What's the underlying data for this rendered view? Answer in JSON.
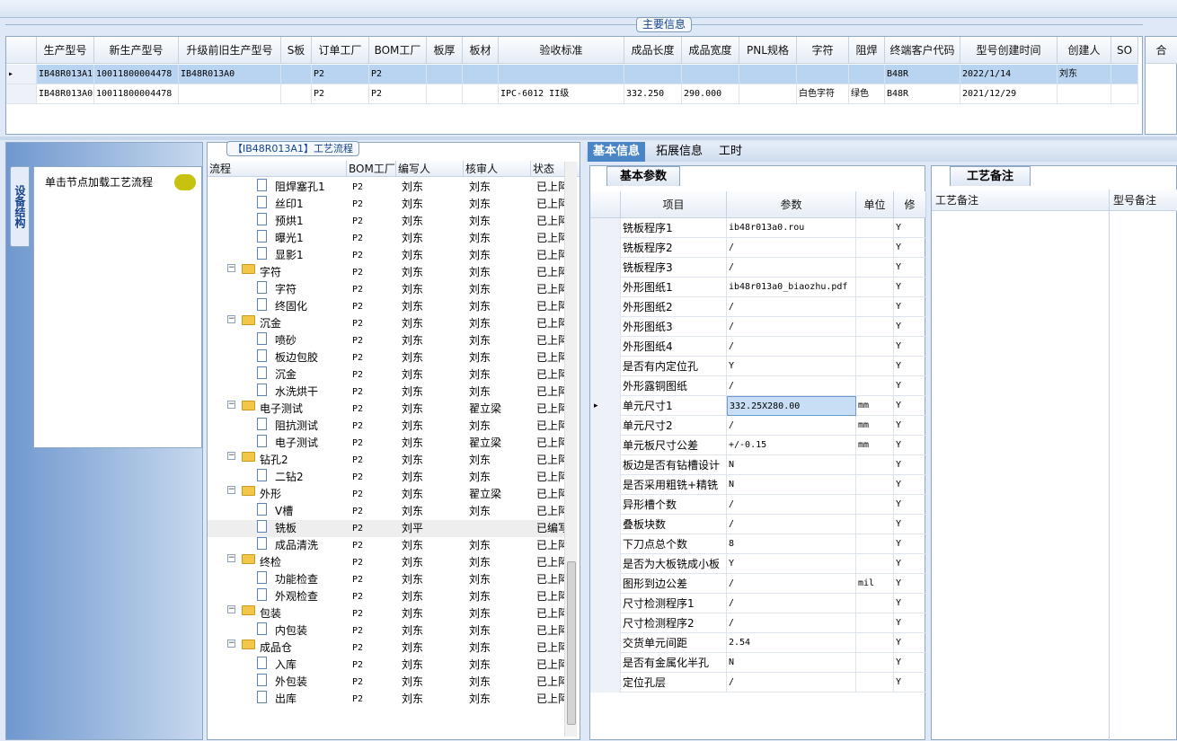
{
  "group_title": "主要信息",
  "top_grid": {
    "headers": [
      "生产型号",
      "新生产型号",
      "升级前旧生产型号",
      "S板",
      "订单工厂",
      "BOM工厂",
      "板厚",
      "板材",
      "验收标准",
      "成品长度",
      "成品宽度",
      "PNL规格",
      "字符",
      "阻焊",
      "终端客户代码",
      "型号创建时间",
      "创建人",
      "SO"
    ],
    "rows": [
      [
        "IB48R013A1",
        "10011800004478",
        "IB48R013A0",
        "",
        "P2",
        "P2",
        "",
        "",
        "",
        "",
        "",
        "",
        "",
        "",
        "B48R",
        "2022/1/14",
        "刘东",
        ""
      ],
      [
        "IB48R013A0",
        "10011800004478",
        "",
        "",
        "P2",
        "P2",
        "",
        "",
        "IPC-6012 II级",
        "332.250",
        "290.000",
        "",
        "白色字符",
        "绿色",
        "B48R",
        "2021/12/29",
        "",
        ""
      ]
    ],
    "extra_header": "合"
  },
  "left_panel": {
    "side_tab": "设备结构",
    "hint": "单击节点加载工艺流程"
  },
  "flow": {
    "title": "【IB48R013A1】工艺流程",
    "headers": [
      "流程",
      "BOM工厂",
      "编写人",
      "核审人",
      "状态"
    ],
    "rows": [
      {
        "name": "阻焊塞孔1",
        "level": 2,
        "bom": "P2",
        "writer": "刘东",
        "checker": "刘东",
        "status": "已上阿"
      },
      {
        "name": "丝印1",
        "level": 2,
        "bom": "P2",
        "writer": "刘东",
        "checker": "刘东",
        "status": "已上阿"
      },
      {
        "name": "预烘1",
        "level": 2,
        "bom": "P2",
        "writer": "刘东",
        "checker": "刘东",
        "status": "已上阿"
      },
      {
        "name": "曝光1",
        "level": 2,
        "bom": "P2",
        "writer": "刘东",
        "checker": "刘东",
        "status": "已上阿"
      },
      {
        "name": "显影1",
        "level": 2,
        "bom": "P2",
        "writer": "刘东",
        "checker": "刘东",
        "status": "已上阿"
      },
      {
        "name": "字符",
        "level": 1,
        "bom": "P2",
        "writer": "刘东",
        "checker": "刘东",
        "status": "已上阿"
      },
      {
        "name": "字符",
        "level": 2,
        "bom": "P2",
        "writer": "刘东",
        "checker": "刘东",
        "status": "已上阿"
      },
      {
        "name": "终固化",
        "level": 2,
        "bom": "P2",
        "writer": "刘东",
        "checker": "刘东",
        "status": "已上阿"
      },
      {
        "name": "沉金",
        "level": 1,
        "bom": "P2",
        "writer": "刘东",
        "checker": "刘东",
        "status": "已上阿"
      },
      {
        "name": "喷砂",
        "level": 2,
        "bom": "P2",
        "writer": "刘东",
        "checker": "刘东",
        "status": "已上阿"
      },
      {
        "name": "板边包胶",
        "level": 2,
        "bom": "P2",
        "writer": "刘东",
        "checker": "刘东",
        "status": "已上阿"
      },
      {
        "name": "沉金",
        "level": 2,
        "bom": "P2",
        "writer": "刘东",
        "checker": "刘东",
        "status": "已上阿"
      },
      {
        "name": "水洗烘干",
        "level": 2,
        "bom": "P2",
        "writer": "刘东",
        "checker": "刘东",
        "status": "已上阿"
      },
      {
        "name": "电子测试",
        "level": 1,
        "bom": "P2",
        "writer": "刘东",
        "checker": "翟立梁",
        "status": "已上阿"
      },
      {
        "name": "阻抗测试",
        "level": 2,
        "bom": "P2",
        "writer": "刘东",
        "checker": "刘东",
        "status": "已上阿"
      },
      {
        "name": "电子测试",
        "level": 2,
        "bom": "P2",
        "writer": "刘东",
        "checker": "翟立梁",
        "status": "已上阿"
      },
      {
        "name": "钻孔2",
        "level": 1,
        "bom": "P2",
        "writer": "刘东",
        "checker": "刘东",
        "status": "已上阿"
      },
      {
        "name": "二钻2",
        "level": 2,
        "bom": "P2",
        "writer": "刘东",
        "checker": "刘东",
        "status": "已上阿"
      },
      {
        "name": "外形",
        "level": 1,
        "bom": "P2",
        "writer": "刘东",
        "checker": "翟立梁",
        "status": "已上阿"
      },
      {
        "name": "V槽",
        "level": 2,
        "bom": "P2",
        "writer": "刘东",
        "checker": "刘东",
        "status": "已上阿"
      },
      {
        "name": "铣板",
        "level": 2,
        "bom": "P2",
        "writer": "刘平",
        "checker": "",
        "status": "已编写"
      },
      {
        "name": "成品清洗",
        "level": 2,
        "bom": "P2",
        "writer": "刘东",
        "checker": "刘东",
        "status": "已上阿"
      },
      {
        "name": "终检",
        "level": 1,
        "bom": "P2",
        "writer": "刘东",
        "checker": "刘东",
        "status": "已上阿"
      },
      {
        "name": "功能检查",
        "level": 2,
        "bom": "P2",
        "writer": "刘东",
        "checker": "刘东",
        "status": "已上阿"
      },
      {
        "name": "外观检查",
        "level": 2,
        "bom": "P2",
        "writer": "刘东",
        "checker": "刘东",
        "status": "已上阿"
      },
      {
        "name": "包装",
        "level": 1,
        "bom": "P2",
        "writer": "刘东",
        "checker": "刘东",
        "status": "已上阿"
      },
      {
        "name": "内包装",
        "level": 2,
        "bom": "P2",
        "writer": "刘东",
        "checker": "刘东",
        "status": "已上阿"
      },
      {
        "name": "成品仓",
        "level": 1,
        "bom": "P2",
        "writer": "刘东",
        "checker": "刘东",
        "status": "已上阿"
      },
      {
        "name": "入库",
        "level": 2,
        "bom": "P2",
        "writer": "刘东",
        "checker": "刘东",
        "status": "已上阿"
      },
      {
        "name": "外包装",
        "level": 2,
        "bom": "P2",
        "writer": "刘东",
        "checker": "刘东",
        "status": "已上阿"
      },
      {
        "name": "出库",
        "level": 2,
        "bom": "P2",
        "writer": "刘东",
        "checker": "刘东",
        "status": "已上阿"
      }
    ]
  },
  "detail_tabs": [
    "基本信息",
    "拓展信息",
    "工时"
  ],
  "params": {
    "title": "基本参数",
    "headers": [
      "项目",
      "参数",
      "单位",
      "修"
    ],
    "rows": [
      [
        "铣板程序1",
        "ib48r013a0.rou",
        "",
        "Y"
      ],
      [
        "铣板程序2",
        "/",
        "",
        "Y"
      ],
      [
        "铣板程序3",
        "/",
        "",
        "Y"
      ],
      [
        "外形图纸1",
        "ib48r013a0_biaozhu.pdf",
        "",
        "Y"
      ],
      [
        "外形图纸2",
        "/",
        "",
        "Y"
      ],
      [
        "外形图纸3",
        "/",
        "",
        "Y"
      ],
      [
        "外形图纸4",
        "/",
        "",
        "Y"
      ],
      [
        "是否有内定位孔",
        "Y",
        "",
        "Y"
      ],
      [
        "外形露铜图纸",
        "/",
        "",
        "Y"
      ],
      [
        "单元尺寸1",
        "332.25X280.00",
        "mm",
        "Y"
      ],
      [
        "单元尺寸2",
        "/",
        "mm",
        "Y"
      ],
      [
        "单元板尺寸公差",
        "+/-0.15",
        "mm",
        "Y"
      ],
      [
        "板边是否有钻槽设计",
        "N",
        "",
        "Y"
      ],
      [
        "是否采用粗铣+精铣",
        "N",
        "",
        "Y"
      ],
      [
        "异形槽个数",
        "/",
        "",
        "Y"
      ],
      [
        "叠板块数",
        "/",
        "",
        "Y"
      ],
      [
        "下刀点总个数",
        "8",
        "",
        "Y"
      ],
      [
        "是否为大板铣成小板",
        "Y",
        "",
        "Y"
      ],
      [
        "图形到边公差",
        "/",
        "mil",
        "Y"
      ],
      [
        "尺寸检测程序1",
        "/",
        "",
        "Y"
      ],
      [
        "尺寸检测程序2",
        "/",
        "",
        "Y"
      ],
      [
        "交货单元间距",
        "2.54",
        "",
        "Y"
      ],
      [
        "是否有金属化半孔",
        "N",
        "",
        "Y"
      ],
      [
        "定位孔层",
        "/",
        "",
        "Y"
      ]
    ]
  },
  "remarks": {
    "title": "工艺备注",
    "col1": "工艺备注",
    "col2": "型号备注"
  }
}
